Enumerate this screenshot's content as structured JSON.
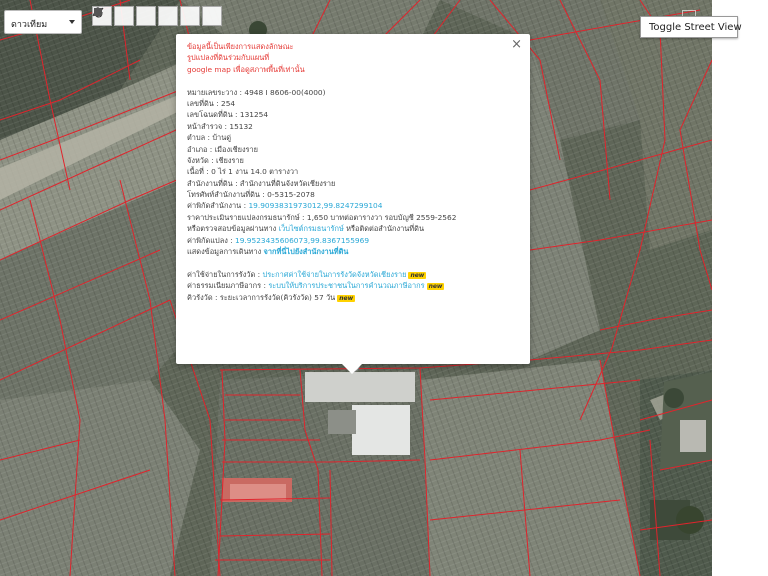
{
  "map_controls": {
    "map_type": "ดาวเทียม",
    "tools": [
      "hand-icon",
      "marker-icon",
      "polyline-icon",
      "rectangle-icon",
      "circle-icon",
      "polygon-icon"
    ],
    "street_view_label": "Toggle Street View"
  },
  "popup": {
    "notice": [
      "ข้อมูลนี้เป็นเพียงการแสดงลักษณะ",
      "รูปแปลงที่ดินร่วมกับแผนที่",
      "google map เพื่อดูสภาพพื้นที่เท่านั้น"
    ],
    "fields": [
      {
        "label": "หมายเลขระวาง : ",
        "value": "4948 I 8606-00(4000)"
      },
      {
        "label": "เลขที่ดิน : ",
        "value": "254"
      },
      {
        "label": "เลขโฉนดที่ดิน : ",
        "value": "131254"
      },
      {
        "label": "หน้าสำรวจ : ",
        "value": "15132"
      },
      {
        "label": "ตำบล : ",
        "value": "บ้านดู่"
      },
      {
        "label": "อำเภอ : ",
        "value": "เมืองเชียงราย"
      },
      {
        "label": "จังหวัด : ",
        "value": "เชียงราย"
      },
      {
        "label": "เนื้อที่ : ",
        "value": "0 ไร่ 1 งาน 14.0 ตารางวา"
      },
      {
        "label": "สำนักงานที่ดิน : ",
        "value": "สำนักงานที่ดินจังหวัดเชียงราย"
      },
      {
        "label": "โทรศัพท์สำนักงานที่ดิน : ",
        "value": "0-5315-2078"
      }
    ],
    "office_coord_label": "ค่าพิกัดสำนักงาน : ",
    "office_coord": "19.9093831973012,99.8247299104",
    "price_line": "ราคาประเมินรายแปลงกรมธนารักษ์ : 1,650 บาทต่อตารางวา รอบบัญชี 2559-2562",
    "check_prefix": "หรือตรวจสอบข้อมูลผ่านทาง ",
    "check_link": "เว็บไซต์กรมธนารักษ์",
    "check_suffix": " หรือติดต่อสำนักงานที่ดิน",
    "parcel_coord_label": "ค่าพิกัดแปลง : ",
    "parcel_coord": "19.9523435606073,99.8367155969",
    "route_prefix": "แสดงข้อมูลการเดินทาง ",
    "route_link": "จากที่นี่ไปยังสำนักงานที่ดิน",
    "extra": [
      {
        "label": "ค่าใช้จ่ายในการรังวัด : ",
        "link": "ประกาศค่าใช้จ่ายในการรังวัดจังหวัดเชียงราย",
        "badge": "new"
      },
      {
        "label": "ค่าธรรมเนียมภาษีอากร : ",
        "link": "ระบบให้บริการประชาชนในการคำนวณภาษีอากร",
        "badge": "new"
      },
      {
        "label": "คิวรังวัด : ",
        "text": "ระยะเวลาการรังวัด(คิวรังวัด) 57 วัน",
        "badge": "new"
      }
    ],
    "close_symbol": "×"
  },
  "colors": {
    "parcel_line": "#e0242c",
    "notice_text": "#e53935",
    "link_text": "#2aa8d6",
    "badge_bg": "#ffd200"
  }
}
